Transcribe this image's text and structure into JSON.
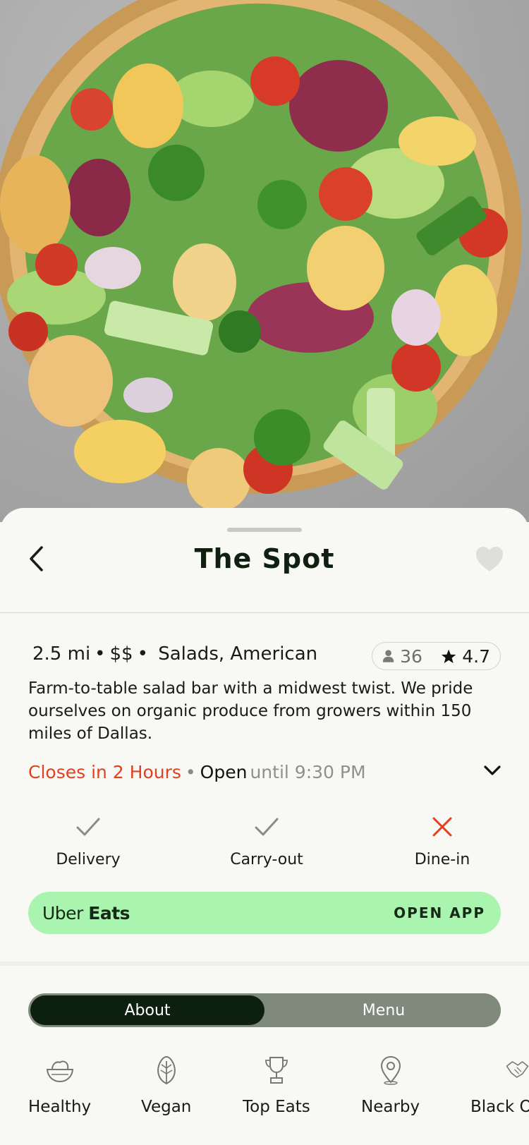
{
  "restaurant": {
    "name": "The Spot",
    "distance": "2.5 mi",
    "price": "$$",
    "cuisines": "Salads, American",
    "review_count": "36",
    "rating": "4.7",
    "description": "Farm-to-table salad bar with a midwest twist. We pride ourselves on organic produce from growers within 150 miles of Dallas.",
    "closing_note": "Closes in 2 Hours",
    "status": "Open",
    "hours_text": "until 9:30 PM"
  },
  "icons": {
    "back": "chevron-left-icon",
    "favorite": "heart-icon",
    "expand": "chevron-down-icon",
    "reviews": "person-icon",
    "rating": "star-icon"
  },
  "services": [
    {
      "label": "Delivery",
      "available": true
    },
    {
      "label": "Carry-out",
      "available": true
    },
    {
      "label": "Dine-in",
      "available": false
    }
  ],
  "partner": {
    "brand_light": "Uber",
    "brand_bold": "Eats",
    "action": "OPEN APP"
  },
  "tabs": [
    {
      "label": "About",
      "active": true
    },
    {
      "label": "Menu",
      "active": false
    }
  ],
  "categories": [
    {
      "label": "Healthy",
      "icon": "salad-bowl-icon"
    },
    {
      "label": "Vegan",
      "icon": "leaf-icon"
    },
    {
      "label": "Top Eats",
      "icon": "trophy-icon"
    },
    {
      "label": "Nearby",
      "icon": "location-pin-icon"
    },
    {
      "label": "Black O",
      "icon": "handshake-icon"
    }
  ],
  "colors": {
    "accent_red": "#e2401f",
    "uber_green": "#a9f4ae",
    "dark_green": "#0d1f0e",
    "segment_bg": "#7f8a7c"
  }
}
